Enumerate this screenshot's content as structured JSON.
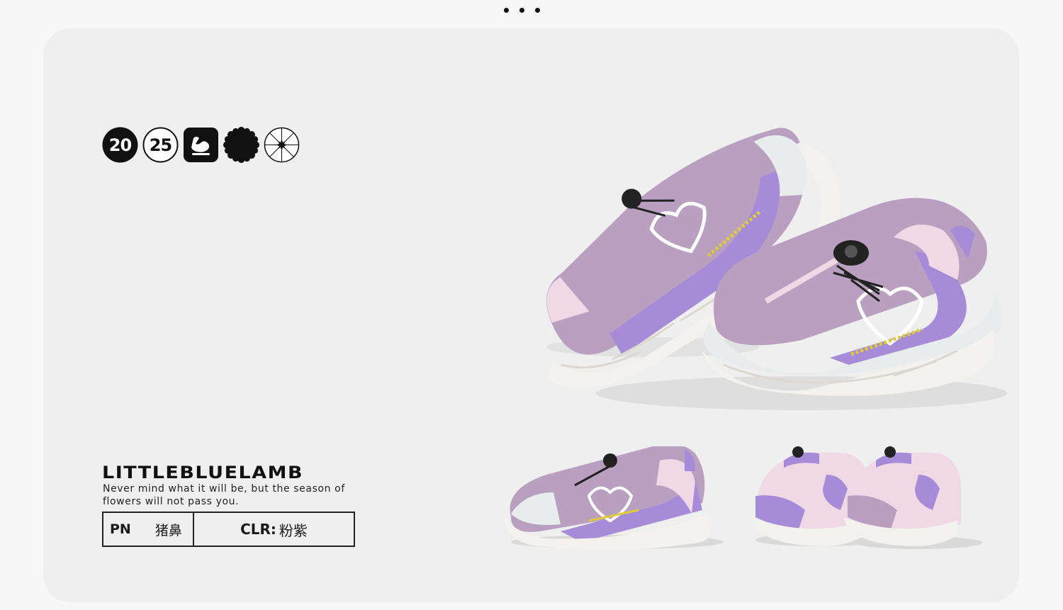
{
  "pager": {
    "dots": 3
  },
  "badges": [
    {
      "type": "number",
      "label": "20",
      "style": "dark"
    },
    {
      "type": "number",
      "label": "25",
      "style": "light"
    },
    {
      "type": "icon",
      "icon": "foot-icon",
      "style": "dark"
    },
    {
      "type": "icon",
      "icon": "flower-icon",
      "style": "dark"
    },
    {
      "type": "icon",
      "icon": "star-wheel-icon",
      "style": "light"
    }
  ],
  "brand": {
    "name": "LITTLEBLUELAMB"
  },
  "tagline": "Never mind what it will be, but the season of flowers will not pass you.",
  "info": {
    "pn_label": "PN",
    "pn_value": "猪鼻",
    "clr_label": "CLR:",
    "clr_value": "粉紫"
  },
  "colors": {
    "upper": "#b9a0c0",
    "panel": "#a58bd8",
    "toe": "#e9ecec",
    "sole": "#f4f2ee",
    "stitch": "#e0c93a",
    "background": "#efefef"
  },
  "images": [
    {
      "name": "hero-shoe-pair",
      "description": "pair of lilac sneakers with dial lace"
    },
    {
      "name": "side-view-shoe"
    },
    {
      "name": "rear-view-shoes"
    }
  ]
}
